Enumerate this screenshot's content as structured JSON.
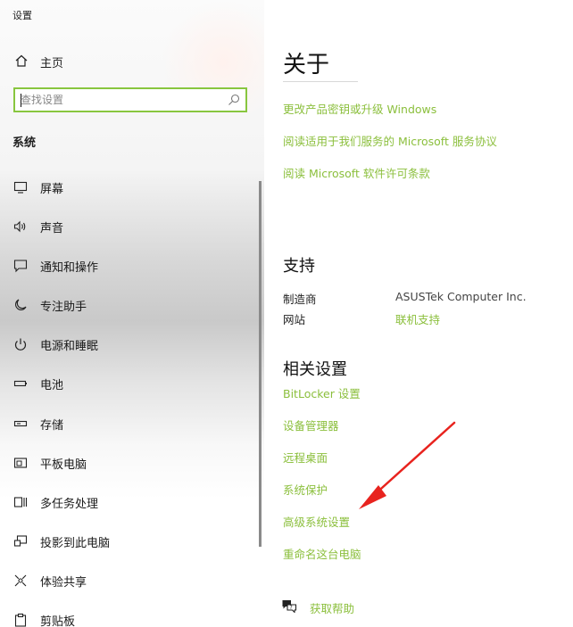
{
  "window": {
    "title": "设置"
  },
  "sidebar": {
    "home_label": "主页",
    "search": {
      "placeholder": "查找设置",
      "value": ""
    },
    "section_title": "系统",
    "items": [
      {
        "label": "屏幕",
        "icon": "monitor-icon"
      },
      {
        "label": "声音",
        "icon": "speaker-icon"
      },
      {
        "label": "通知和操作",
        "icon": "notification-icon"
      },
      {
        "label": "专注助手",
        "icon": "moon-icon"
      },
      {
        "label": "电源和睡眠",
        "icon": "power-icon",
        "active": true
      },
      {
        "label": "电池",
        "icon": "battery-icon"
      },
      {
        "label": "存储",
        "icon": "storage-icon"
      },
      {
        "label": "平板电脑",
        "icon": "tablet-icon"
      },
      {
        "label": "多任务处理",
        "icon": "multitasking-icon"
      },
      {
        "label": "投影到此电脑",
        "icon": "project-icon"
      },
      {
        "label": "体验共享",
        "icon": "share-icon"
      },
      {
        "label": "剪贴板",
        "icon": "clipboard-icon"
      }
    ]
  },
  "main": {
    "about_title": "关于",
    "about_links": [
      "更改产品密钥或升级 Windows",
      "阅读适用于我们服务的 Microsoft 服务协议",
      "阅读 Microsoft 软件许可条款"
    ],
    "support": {
      "title": "支持",
      "manufacturer_label": "制造商",
      "manufacturer_value": "ASUSTek Computer Inc.",
      "website_label": "网站",
      "website_value": "联机支持"
    },
    "related": {
      "title": "相关设置",
      "links": [
        "BitLocker 设置",
        "设备管理器",
        "远程桌面",
        "系统保护",
        "高级系统设置",
        "重命名这台电脑"
      ]
    },
    "help_label": "获取帮助"
  },
  "colors": {
    "accent_link": "#8bbf3c",
    "search_border": "#88c63f",
    "annotation_arrow": "#e8231e"
  }
}
